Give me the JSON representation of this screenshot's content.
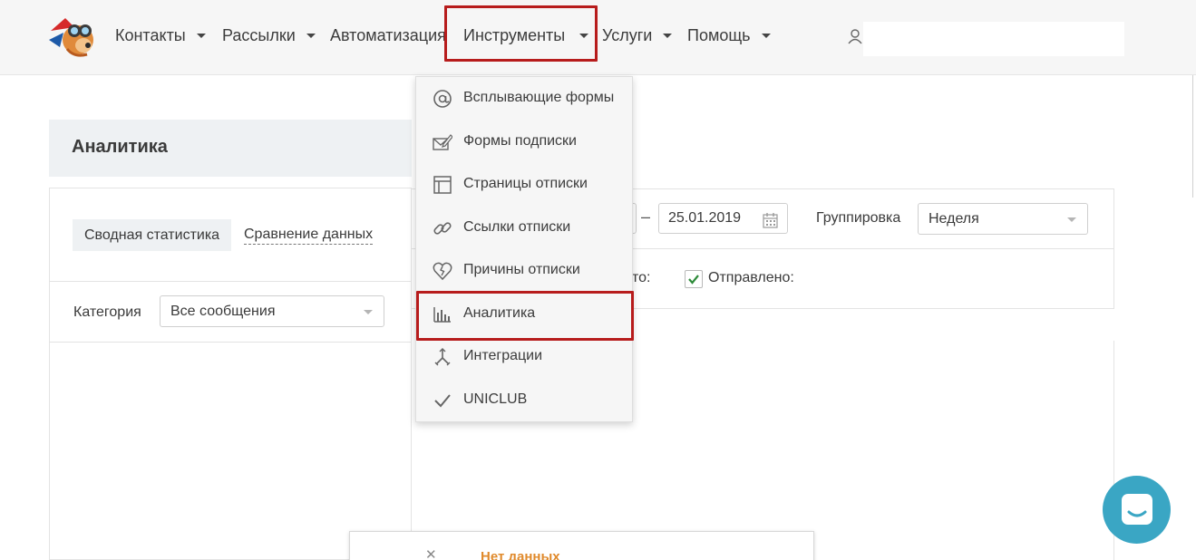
{
  "nav": {
    "items": [
      {
        "label": "Контакты",
        "has_caret": true
      },
      {
        "label": "Рассылки",
        "has_caret": true
      },
      {
        "label": "Автоматизация",
        "has_caret": false
      },
      {
        "label": "Инструменты",
        "has_caret": true,
        "highlighted": true
      },
      {
        "label": "Услуги",
        "has_caret": true
      },
      {
        "label": "Помощь",
        "has_caret": true
      }
    ],
    "user_icon": "user-icon",
    "search_value": ""
  },
  "dropdown": {
    "items": [
      {
        "label": "Всплывающие формы",
        "icon": "at-icon"
      },
      {
        "label": "Формы подписки",
        "icon": "envelope-pen-icon"
      },
      {
        "label": "Страницы отписки",
        "icon": "window-icon"
      },
      {
        "label": "Ссылки отписки",
        "icon": "link-icon"
      },
      {
        "label": "Причины отписки",
        "icon": "broken-heart-icon"
      },
      {
        "label": "Аналитика",
        "icon": "bar-chart-icon",
        "highlighted": true
      },
      {
        "label": "Интеграции",
        "icon": "integration-icon"
      },
      {
        "label": "UNICLUB",
        "icon": "check-icon"
      }
    ]
  },
  "page": {
    "section_title": "Аналитика",
    "tabs": [
      {
        "label": "Сводная статистика",
        "active": true
      },
      {
        "label": "Сравнение данных",
        "active": false
      }
    ],
    "category": {
      "label": "Категория",
      "value": "Все сообщения"
    },
    "date_end": "25.01.2019",
    "date_separator": "–",
    "grouping": {
      "label": "Группировка",
      "value": "Неделя"
    },
    "partial_label": "то:",
    "sent": {
      "label": "Отправлено:",
      "checked": true
    },
    "no_data": {
      "message": "Нет данных"
    }
  },
  "colors": {
    "highlight_border": "#b71c1c",
    "chat_button": "#3aa6c4",
    "no_data_text": "#e08a2c",
    "checkbox_check": "#2e8b3a"
  }
}
